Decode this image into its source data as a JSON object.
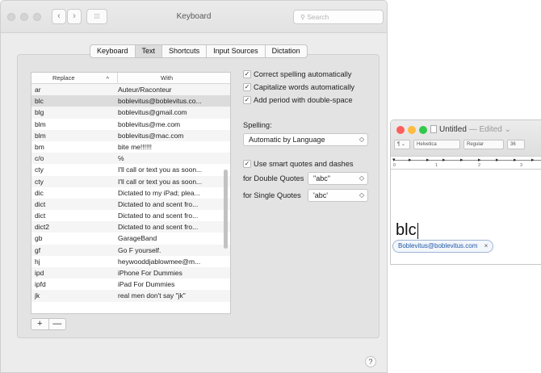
{
  "prefs": {
    "title": "Keyboard",
    "search_placeholder": "Search",
    "nav": {
      "back": "‹",
      "forward": "›",
      "grid": "⁞⁞⁞"
    },
    "tabs": [
      "Keyboard",
      "Text",
      "Shortcuts",
      "Input Sources",
      "Dictation"
    ],
    "active_tab": "Text",
    "table": {
      "col_replace": "Replace",
      "col_with": "With",
      "sort_arrow": "^",
      "rows": [
        {
          "replace": "ar",
          "with": "Auteur/Raconteur"
        },
        {
          "replace": "blc",
          "with": "boblevitus@boblevitus.co..."
        },
        {
          "replace": "blg",
          "with": "boblevitus@gmail.com"
        },
        {
          "replace": "blm",
          "with": "boblevitus@me.com"
        },
        {
          "replace": "blm",
          "with": "boblevitus@mac.com"
        },
        {
          "replace": "bm",
          "with": "bite me!!!!!!"
        },
        {
          "replace": "c/o",
          "with": "℅"
        },
        {
          "replace": "cty",
          "with": "I'll call or text you as soon..."
        },
        {
          "replace": "cty",
          "with": "I'll call or text you as soon..."
        },
        {
          "replace": "dic",
          "with": "Dictated to my iPad; plea..."
        },
        {
          "replace": "dict",
          "with": "Dictated to and scent fro..."
        },
        {
          "replace": "dict",
          "with": "Dictated to and scent fro..."
        },
        {
          "replace": "dict2",
          "with": "Dictated to and scent fro..."
        },
        {
          "replace": "gb",
          "with": "GarageBand"
        },
        {
          "replace": "gf",
          "with": "Go F yourself."
        },
        {
          "replace": "hj",
          "with": "heywooddjablowmee@m..."
        },
        {
          "replace": "ipd",
          "with": "iPhone For Dummies"
        },
        {
          "replace": "ipfd",
          "with": "iPad For Dummies"
        },
        {
          "replace": "jk",
          "with": "real men don't say \"jk\""
        }
      ],
      "selected_index": 1
    },
    "add_label": "+",
    "remove_label": "—",
    "options": {
      "correct_spelling": "Correct spelling automatically",
      "capitalize": "Capitalize words automatically",
      "period": "Add period with double-space",
      "spelling_label": "Spelling:",
      "spelling_value": "Automatic by Language",
      "smart_quotes": "Use smart quotes and dashes",
      "double_label": "for Double Quotes",
      "double_value": "\"abc\"",
      "single_label": "for Single Quotes",
      "single_value": "'abc'",
      "check": "✓",
      "popup_arrow": "◇"
    },
    "help": "?"
  },
  "textedit": {
    "title": "Untitled",
    "edited": "— Edited ⌄",
    "para_style": "¶ ⌄",
    "font": "Helvetica",
    "weight": "Regular",
    "size": "36",
    "ruler_nums": [
      "0",
      "1",
      "2",
      "3"
    ],
    "typed_text": "blc",
    "suggestion": "Boblevitus@boblevitus.com",
    "suggestion_close": "×"
  },
  "colors": {
    "red": "#fc605c",
    "yellow": "#fdbc40",
    "green": "#34c84a",
    "selection": "#dcdcdc"
  }
}
